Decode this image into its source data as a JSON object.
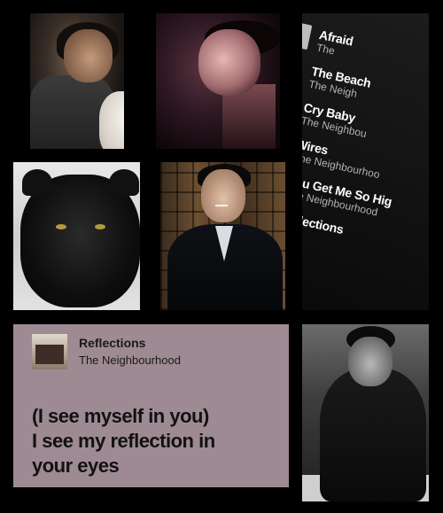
{
  "playlist": {
    "items": [
      {
        "title": "Afraid",
        "artist": "The"
      },
      {
        "title": "The Beach",
        "artist": "The Neigh"
      },
      {
        "title": "Cry Baby",
        "artist": "The Neighbou"
      },
      {
        "title": "Wires",
        "artist": "The Neighbourhoo"
      },
      {
        "title": "You Get Me So Hig",
        "artist": "The Neighbourhood"
      },
      {
        "title": "Reflections",
        "artist": ""
      }
    ]
  },
  "now_playing": {
    "song": "Reflections",
    "artist": "The Neighbourhood",
    "lyrics": [
      "(I see myself in you)",
      "I see my reflection in",
      "your eyes"
    ]
  },
  "colors": {
    "background": "#000000",
    "card": "#9e8a93",
    "card_text": "#121212"
  }
}
